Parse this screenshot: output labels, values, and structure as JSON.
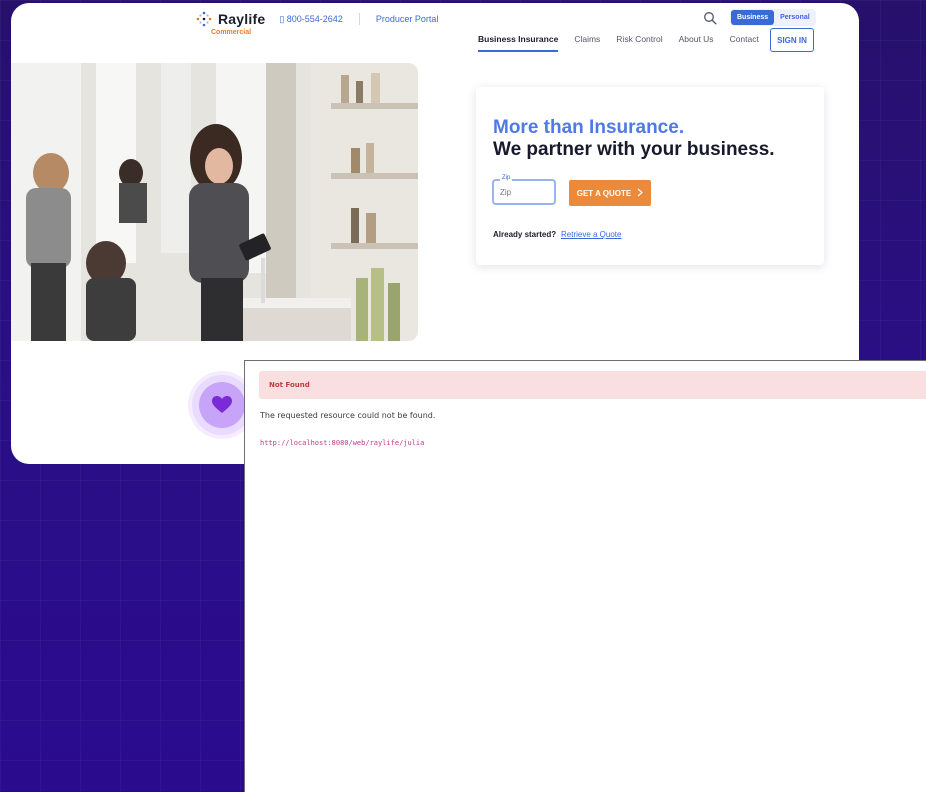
{
  "brand": {
    "name": "Raylife",
    "sub": "Commercial",
    "phone": "800-554-2642",
    "portal_link": "Producer Portal"
  },
  "header": {
    "toggle": {
      "active": "Business",
      "inactive": "Personal"
    },
    "nav": [
      "Business Insurance",
      "Claims",
      "Risk Control",
      "About Us",
      "Contact"
    ],
    "sign_in": "SIGN IN"
  },
  "quote": {
    "headline_1": "More than Insurance.",
    "headline_2": "We partner with your business.",
    "zip_label": "Zip",
    "zip_placeholder": "Zip",
    "button": "GET A QUOTE",
    "already": "Already started?",
    "retrieve": "Retrieve a Quote"
  },
  "error": {
    "title": "Not Found",
    "message": "The requested resource could not be found.",
    "url": "http://localhost:8080/web/raylife/julia"
  },
  "colors": {
    "primary": "#3b69d8",
    "accent": "#ec8a3b",
    "error_bg": "#f9dfe0",
    "background": "#2a0f84"
  }
}
